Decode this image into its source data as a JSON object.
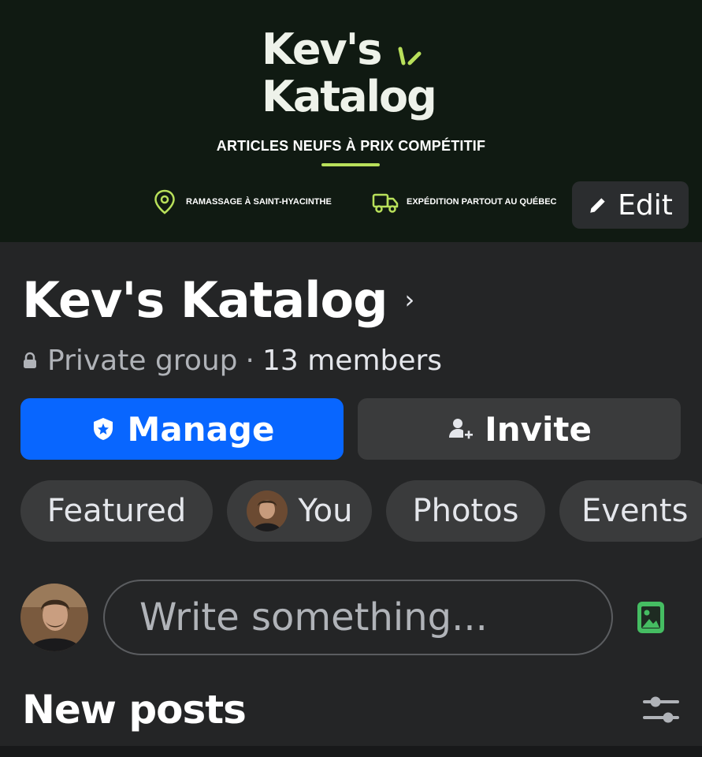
{
  "cover": {
    "logo_line1": "Kev's",
    "logo_line2": "Katalog",
    "tagline": "ARTICLES NEUFS À PRIX COMPÉTITIF",
    "feature_pickup": "RAMASSAGE À SAINT-HYACINTHE",
    "feature_shipping": "EXPÉDITION PARTOUT AU QUÉBEC",
    "accent_color": "#b8e05a",
    "edit_label": "Edit"
  },
  "group": {
    "name": "Kev's Katalog",
    "privacy": "Private group",
    "separator": "·",
    "members": "13 members"
  },
  "actions": {
    "manage_label": "Manage",
    "invite_label": "Invite",
    "manage_color": "#0866ff"
  },
  "tabs": [
    {
      "label": "Featured"
    },
    {
      "label": "You"
    },
    {
      "label": "Photos"
    },
    {
      "label": "Events"
    }
  ],
  "composer": {
    "placeholder": "Write something..."
  },
  "feed": {
    "title": "New posts"
  },
  "icons": {
    "location": "location-pin-icon",
    "truck": "truck-icon",
    "edit": "pencil-icon",
    "lock": "lock-icon",
    "manage": "shield-star-icon",
    "invite": "add-person-icon",
    "photo": "photo-icon",
    "filter": "sliders-icon"
  }
}
